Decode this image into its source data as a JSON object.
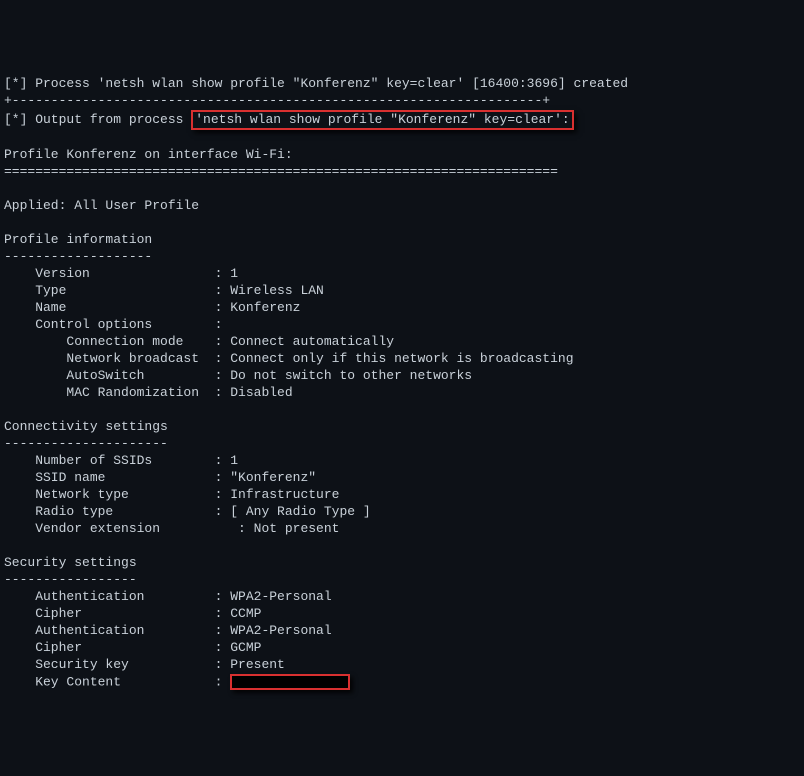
{
  "lines": {
    "l0": "[*] Process 'netsh wlan show profile \"Konferenz\" key=clear' [16400:3696] created",
    "l1": "+--------------------------------------------------------------------+",
    "l2a": "[*] Output from process ",
    "l2b": "'netsh wlan show profile \"Konferenz\" key=clear':",
    "l3": "",
    "l4": "Profile Konferenz on interface Wi-Fi:",
    "l5": "=======================================================================",
    "l6": "",
    "l7": "Applied: All User Profile",
    "l8": "",
    "l9": "Profile information",
    "l10": "-------------------",
    "l11": "    Version                : 1",
    "l12": "    Type                   : Wireless LAN",
    "l13": "    Name                   : Konferenz",
    "l14": "    Control options        :",
    "l15": "        Connection mode    : Connect automatically",
    "l16": "        Network broadcast  : Connect only if this network is broadcasting",
    "l17": "        AutoSwitch         : Do not switch to other networks",
    "l18": "        MAC Randomization  : Disabled",
    "l19": "",
    "l20": "Connectivity settings",
    "l21": "---------------------",
    "l22": "    Number of SSIDs        : 1",
    "l23": "    SSID name              : \"Konferenz\"",
    "l24": "    Network type           : Infrastructure",
    "l25": "    Radio type             : [ Any Radio Type ]",
    "l26": "    Vendor extension          : Not present",
    "l27": "",
    "l28": "Security settings",
    "l29": "-----------------",
    "l30": "    Authentication         : WPA2-Personal",
    "l31": "    Cipher                 : CCMP",
    "l32": "    Authentication         : WPA2-Personal",
    "l33": "    Cipher                 : GCMP",
    "l34": "    Security key           : Present",
    "l35a": "    Key Content            : "
  },
  "colors": {
    "highlight_border": "#d93030",
    "background": "#0d1117",
    "text": "#c9d1d9"
  }
}
